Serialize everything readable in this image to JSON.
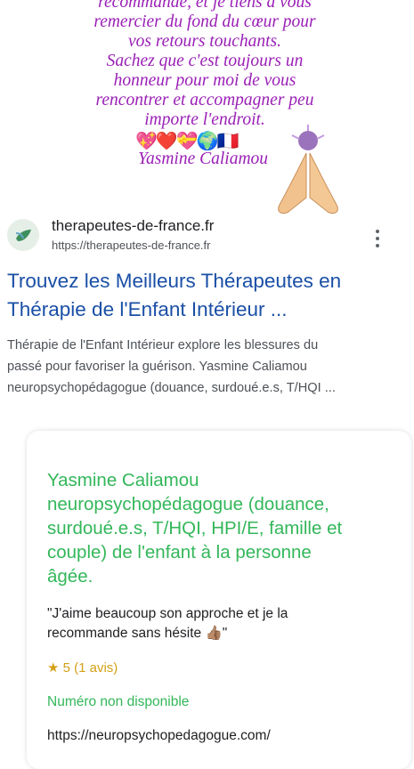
{
  "message": {
    "lines": [
      "recommandé, et je tiens à vous",
      "remercier du fond du cœur pour",
      "vos retours touchants.",
      "Sachez que c'est toujours un",
      "honneur pour moi de vous",
      "rencontrer et accompagner peu",
      "importe l'endroit."
    ],
    "emojis": "💖❤️💝🌍🇫🇷",
    "signature": "Yasmine Caliamou",
    "accent_color": "#9a1fb6"
  },
  "result": {
    "site_name": "therapeutes-de-france.fr",
    "site_url": "https://therapeutes-de-france.fr",
    "title_lines": [
      "Trouvez les Meilleurs Thérapeutes en",
      "Thérapie de l'Enfant Intérieur ..."
    ],
    "snippet_lines": [
      "Thérapie de l'Enfant Intérieur explore les blessures du",
      "passé pour favoriser la guérison. Yasmine Caliamou",
      "neuropsychopédagogue (douance, surdoué.e.s, T/HQI ..."
    ],
    "title_color": "#1a4fa6"
  },
  "card": {
    "title_lines": [
      "Yasmine Caliamou",
      "neuropsychopédagogue (douance,",
      "surdoué.e.s, T/HQI, HPI/E, famille et",
      "couple) de l'enfant à la personne",
      "âgée."
    ],
    "quote_lines": [
      "\"J'aime beaucoup son approche et je la",
      "recommande sans hésite 👍🏽\""
    ],
    "rating": "★ 5 (1 avis)",
    "phone": "Numéro non disponible",
    "link": "https://neuropsychopedagogue.com/",
    "accent_color": "#33b75a"
  },
  "icons": {
    "logo": "leaf-logo-icon",
    "more": "more-vertical-icon",
    "hands": "praying-hands-icon"
  }
}
